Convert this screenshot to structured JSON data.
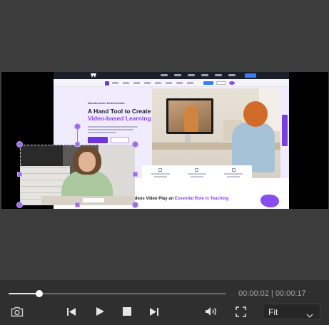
{
  "site": {
    "brand": "Wondershare DemoCreator",
    "hero_title_line1": "A Hand Tool to Create",
    "hero_title_line2": "Video-based Learning",
    "headline_part1": "ideos Video Play an ",
    "headline_part2": "Essential Role in Teaching"
  },
  "player": {
    "progress_fraction": 0.14,
    "current_time": "00:00:02",
    "time_separator": "|",
    "total_time": "00:00:17",
    "fit_label": "Fit"
  },
  "icons": {
    "screenshot": "camera-icon",
    "previous": "skip-previous-icon",
    "play": "play-icon",
    "stop": "stop-icon",
    "next": "skip-next-icon",
    "volume": "volume-icon",
    "fullscreen": "fullscreen-icon",
    "dropdown": "chevron-down-icon"
  },
  "colors": {
    "accent": "#9b6ee6",
    "brand_purple": "#8b3ff2",
    "control_bar": "#2f2f2f"
  }
}
